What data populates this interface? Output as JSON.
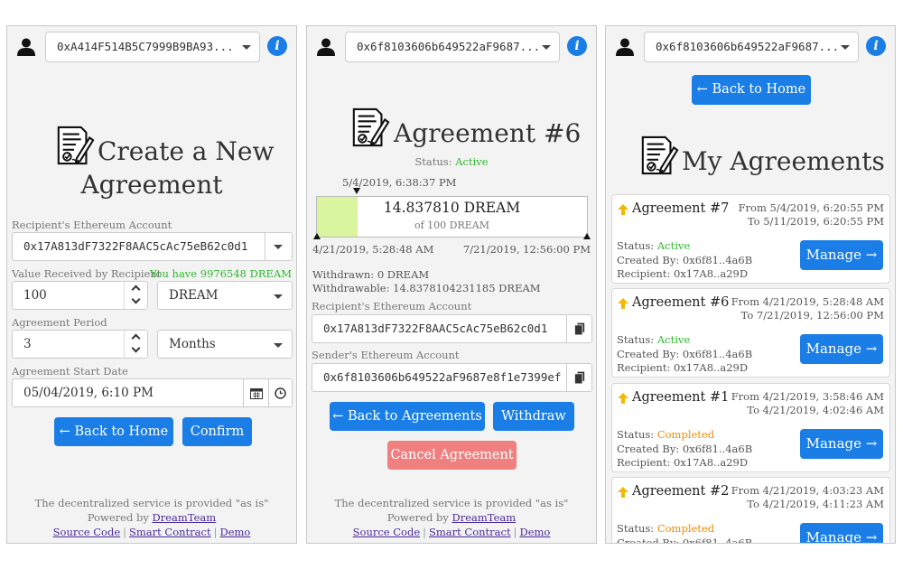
{
  "colors": {
    "primary": "#1a7ee6",
    "danger": "#f08080",
    "active": "#2eb82e",
    "completed": "#f08c00",
    "progress_fill": "#d9f5a0"
  },
  "screen1": {
    "account": "0xA414F514B5C7999B9BA93...",
    "title_line1": "Create a New",
    "title_line2": "Agreement",
    "recipient_label": "Recipient's Ethereum Account",
    "recipient_value": "0x17A813dF7322F8AAC5cAc75eB62c0d1",
    "value_label": "Value Received by Recipient",
    "balance_note": "You have 9976548 DREAM",
    "value": "100",
    "token": "DREAM",
    "period_label": "Agreement Period",
    "period_value": "3",
    "period_unit": "Months",
    "start_label": "Agreement Start Date",
    "start_value": "05/04/2019, 6:10 PM",
    "back_button": "← Back to Home",
    "confirm_button": "Confirm"
  },
  "screen2": {
    "account": "0x6f8103606b649522aF9687...",
    "title": "Agreement #6",
    "status_label": "Status:",
    "status_value": "Active",
    "now_time": "5/4/2019, 6:38:37 PM",
    "amount": "14.837810 DREAM",
    "amount_of": "of 100 DREAM",
    "progress_fraction": 0.148,
    "start_time": "4/21/2019, 5:28:48 AM",
    "end_time": "7/21/2019, 12:56:00 PM",
    "withdrawn_label": "Withdrawn:",
    "withdrawn_value": "0 DREAM",
    "withdrawable_label": "Withdrawable:",
    "withdrawable_value": "14.8378104231185 DREAM",
    "recipient_label": "Recipient's Ethereum Account",
    "recipient_value": "0x17A813dF7322F8AAC5cAc75eB62c0d1",
    "sender_label": "Sender's Ethereum Account",
    "sender_value": "0x6f8103606b649522aF9687e8f1e7399ef",
    "back_button": "← Back to Agreements",
    "withdraw_button": "Withdraw",
    "cancel_button": "Cancel Agreement"
  },
  "screen3": {
    "account": "0x6f8103606b649522aF9687...",
    "back_button": "← Back to Home",
    "title": "My Agreements",
    "status_label": "Status:",
    "created_label": "Created By:",
    "recipient_label": "Recipient:",
    "manage_label": "Manage →",
    "agreements": [
      {
        "title": "Agreement #7",
        "from": "From 5/4/2019, 6:20:55 PM",
        "to": "To 5/11/2019, 6:20:55 PM",
        "status": "Active",
        "created_by": "0x6f81..4a6B",
        "recipient": "0x17A8..a29D"
      },
      {
        "title": "Agreement #6",
        "from": "From 4/21/2019, 5:28:48 AM",
        "to": "To 7/21/2019, 12:56:00 PM",
        "status": "Active",
        "created_by": "0x6f81..4a6B",
        "recipient": "0x17A8..a29D"
      },
      {
        "title": "Agreement #1",
        "from": "From 4/21/2019, 3:58:46 AM",
        "to": "To 4/21/2019, 4:02:46 AM",
        "status": "Completed",
        "created_by": "0x6f81..4a6B",
        "recipient": "0x17A8..a29D"
      },
      {
        "title": "Agreement #2",
        "from": "From 4/21/2019, 4:03:23 AM",
        "to": "To 4/21/2019, 4:11:23 AM",
        "status": "Completed",
        "created_by": "0x6f81..4a6B",
        "recipient": "0x17A8..a29D"
      }
    ]
  },
  "footer": {
    "disclaimer": "The decentralized service is provided \"as is\"",
    "powered_by": "Powered by",
    "team": "DreamTeam",
    "source_code": "Source Code",
    "smart_contract": "Smart Contract",
    "demo": "Demo",
    "separator": "|"
  }
}
